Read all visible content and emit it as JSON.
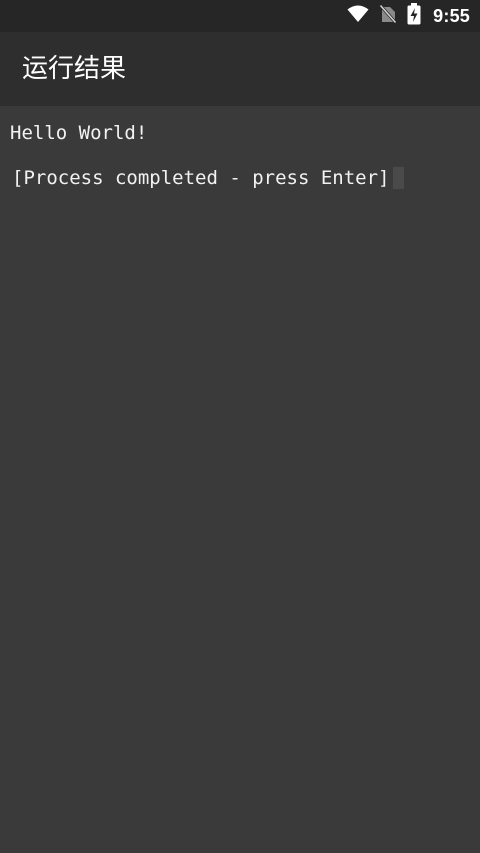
{
  "status_bar": {
    "time": "9:55",
    "icons": [
      "wifi-icon",
      "no-sim-icon",
      "battery-charging-icon"
    ]
  },
  "app_bar": {
    "title": "运行结果"
  },
  "terminal": {
    "lines": [
      "Hello World!",
      "[Process completed - press Enter]"
    ]
  },
  "colors": {
    "background": "#3a3a3a",
    "app_bar": "#2e2e2e",
    "status_bar": "#262626",
    "text": "#f2f2f2"
  }
}
